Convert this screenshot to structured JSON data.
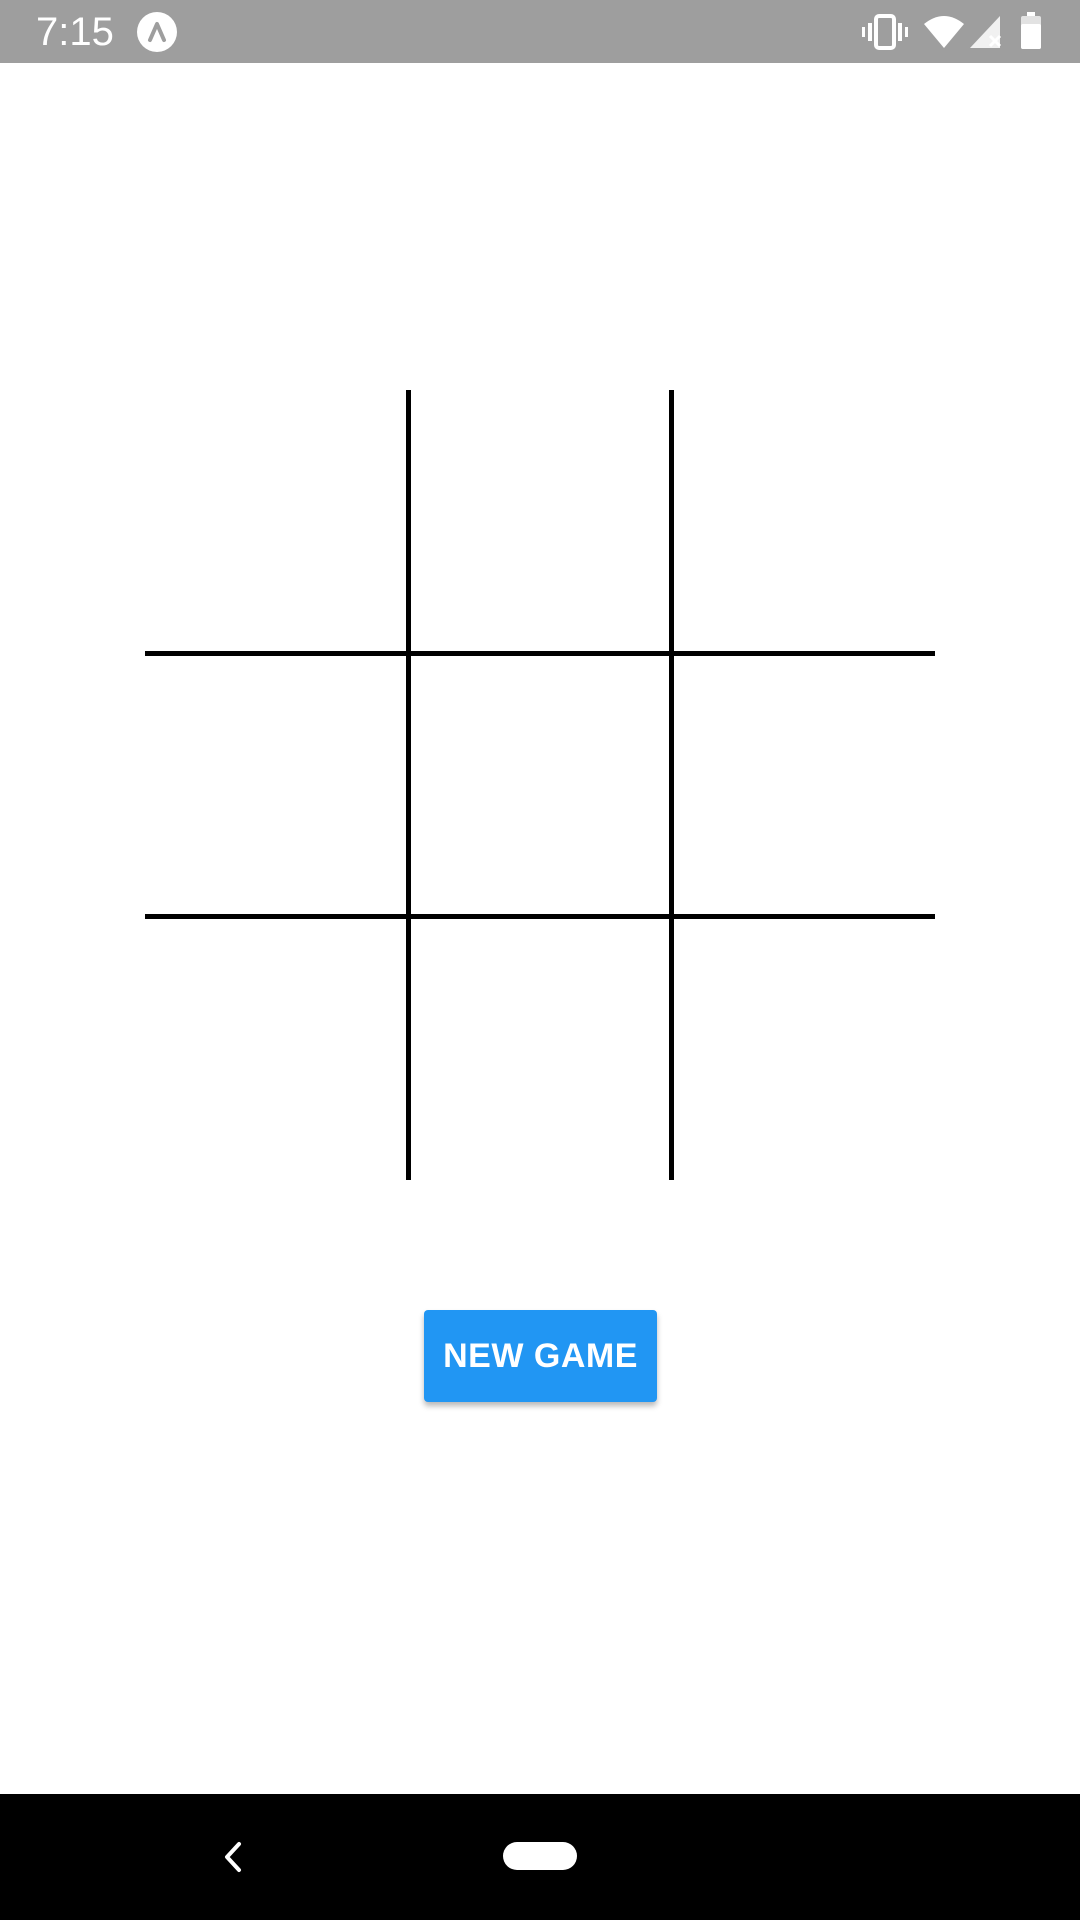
{
  "status_bar": {
    "time": "7:15",
    "icons": [
      "app-notification-icon",
      "vibrate-icon",
      "wifi-icon",
      "cellular-no-signal-icon",
      "battery-icon"
    ],
    "background": "#9e9e9e"
  },
  "board": {
    "rows": 3,
    "cols": 3,
    "cells": [
      "",
      "",
      "",
      "",
      "",
      "",
      "",
      "",
      ""
    ],
    "line_color": "#000000"
  },
  "actions": {
    "new_game_label": "NEW GAME",
    "button_color": "#2196f3"
  },
  "nav_bar": {
    "icons": [
      "back-icon",
      "home-pill-icon"
    ]
  }
}
